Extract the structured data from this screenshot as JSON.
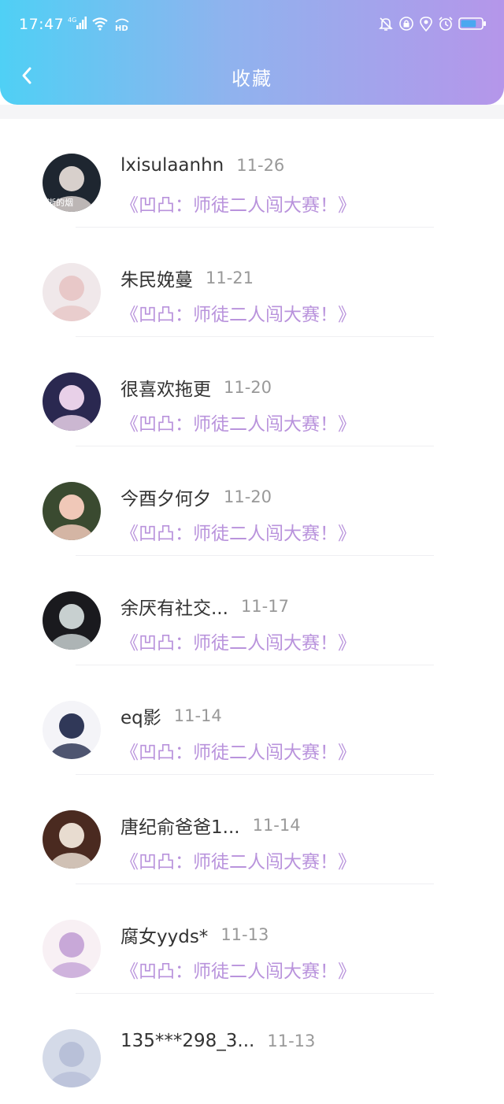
{
  "status_bar": {
    "time": "17:47",
    "network": "4G",
    "hd_badge": "HD",
    "icons": [
      "signal-icon",
      "wifi-icon",
      "hd-icon",
      "bell-off-icon",
      "lock-icon",
      "location-icon",
      "alarm-icon",
      "battery-icon"
    ],
    "battery_level": 0.75
  },
  "header": {
    "title": "收藏",
    "back_icon": "chevron-left-icon",
    "gradient_colors": [
      "#4fd0f5",
      "#8fb3ee",
      "#b596ea"
    ]
  },
  "colors": {
    "title_link": "#b993dc",
    "name": "#333333",
    "date": "#999999"
  },
  "favorites": [
    {
      "name": "lxisulaanhn",
      "date": "11-26",
      "title": "《凹凸：师徒二人闯大赛！》",
      "avatar_colors": [
        "#1e2630",
        "#d8d0cc"
      ],
      "avatar_label": "逝的烟"
    },
    {
      "name": "朱民娩蔓",
      "date": "11-21",
      "title": "《凹凸：师徒二人闯大赛！》",
      "avatar_colors": [
        "#f0e8ea",
        "#e8c8c8"
      ]
    },
    {
      "name": "很喜欢拖更",
      "date": "11-20",
      "title": "《凹凸：师徒二人闯大赛！》",
      "avatar_colors": [
        "#2a2850",
        "#e8d0e8"
      ]
    },
    {
      "name": "今酉夕何夕",
      "date": "11-20",
      "title": "《凹凸：师徒二人闯大赛！》",
      "avatar_colors": [
        "#3a4a30",
        "#f0c8b8"
      ]
    },
    {
      "name": "余厌有社交...",
      "date": "11-17",
      "title": "《凹凸：师徒二人闯大赛！》",
      "avatar_colors": [
        "#1a1a1e",
        "#c8d0d0"
      ]
    },
    {
      "name": "eq影",
      "date": "11-14",
      "title": "《凹凸：师徒二人闯大赛！》",
      "avatar_colors": [
        "#f4f4f8",
        "#303858"
      ]
    },
    {
      "name": "唐纪俞爸爸1...",
      "date": "11-14",
      "title": "《凹凸：师徒二人闯大赛！》",
      "avatar_colors": [
        "#4a2a20",
        "#e8dcd0"
      ]
    },
    {
      "name": "腐女yyds*",
      "date": "11-13",
      "title": "《凹凸：师徒二人闯大赛！》",
      "avatar_colors": [
        "#f8f0f4",
        "#c8a8d8"
      ]
    },
    {
      "name": "135***298_3...",
      "date": "11-13",
      "title": "",
      "avatar_colors": [
        "#d4dae8",
        "#b8c0d8"
      ]
    }
  ]
}
